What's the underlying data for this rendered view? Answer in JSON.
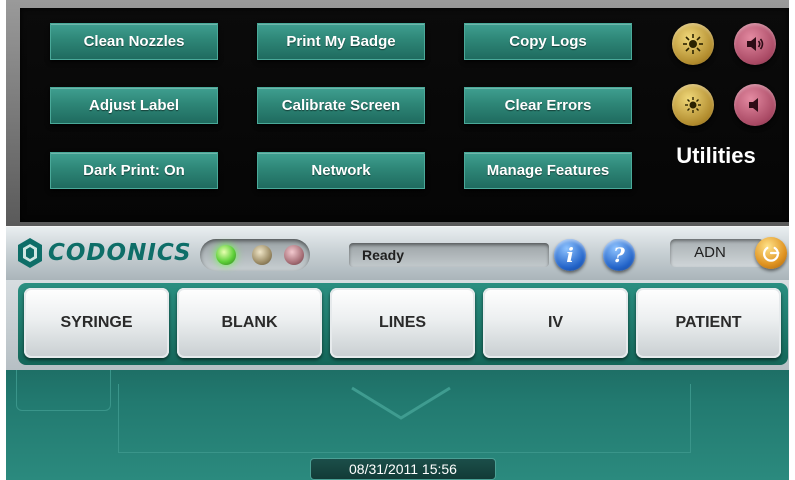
{
  "utilities": {
    "title": "Utilities",
    "buttons": [
      {
        "label": "Clean Nozzles"
      },
      {
        "label": "Print My Badge"
      },
      {
        "label": "Copy Logs"
      },
      {
        "label": "Adjust Label"
      },
      {
        "label": "Calibrate Screen"
      },
      {
        "label": "Clear Errors"
      },
      {
        "label": "Dark Print: On"
      },
      {
        "label": "Network"
      },
      {
        "label": "Manage Features"
      }
    ],
    "controls": [
      {
        "icon": "brightness-up-icon"
      },
      {
        "icon": "volume-up-icon"
      },
      {
        "icon": "brightness-down-icon"
      },
      {
        "icon": "volume-down-icon"
      }
    ]
  },
  "status_bar": {
    "logo_text": "CODONICS",
    "indicators": [
      "green",
      "amber",
      "red"
    ],
    "status_text": "Ready",
    "user": "ADN"
  },
  "tabs": [
    {
      "label": "SYRINGE"
    },
    {
      "label": "BLANK"
    },
    {
      "label": "LINES"
    },
    {
      "label": "IV"
    },
    {
      "label": "PATIENT"
    }
  ],
  "footer": {
    "datetime": "08/31/2011 15:56"
  },
  "colors": {
    "accent_teal": "#2e8677",
    "brand": "#0e6e68",
    "panel_black": "#0b0b0b"
  }
}
